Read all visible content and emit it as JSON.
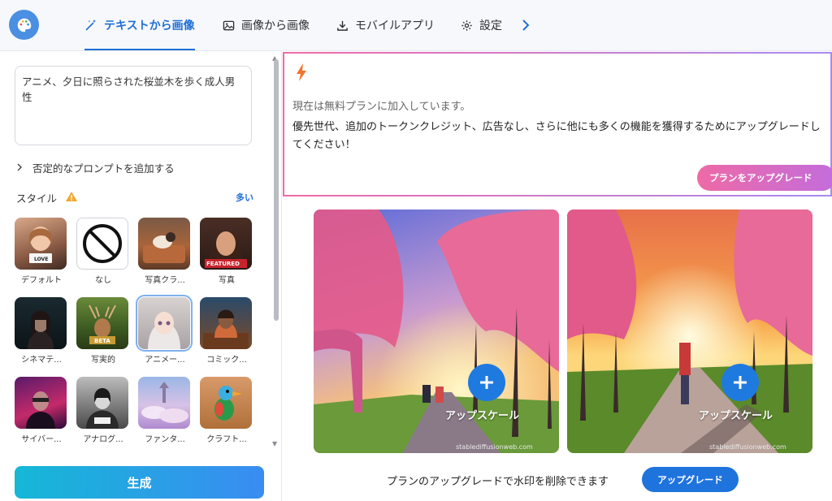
{
  "tabs": [
    {
      "label": "テキストから画像",
      "icon": "magic-wand-icon"
    },
    {
      "label": "画像から画像",
      "icon": "image-icon"
    },
    {
      "label": "モバイルアプリ",
      "icon": "download-icon"
    },
    {
      "label": "設定",
      "icon": "gear-icon"
    }
  ],
  "prompt": {
    "value": "アニメ、夕日に照らされた桜並木を歩く成人男性"
  },
  "negative_prompt_label": "否定的なプロンプトを追加する",
  "style": {
    "header": "スタイル",
    "more": "多い",
    "items": [
      {
        "label": "デフォルト",
        "badge": "LOVE"
      },
      {
        "label": "なし"
      },
      {
        "label": "写真クラ..."
      },
      {
        "label": "写真",
        "badge": "FEATURED"
      },
      {
        "label": "シネマテ..."
      },
      {
        "label": "写実的",
        "badge": "BETA"
      },
      {
        "label": "アニメー..."
      },
      {
        "label": "コミック..."
      },
      {
        "label": "サイバー..."
      },
      {
        "label": "アナログ..."
      },
      {
        "label": "ファンタ..."
      },
      {
        "label": "クラフト..."
      }
    ]
  },
  "generate_label": "生成",
  "banner": {
    "line1": "現在は無料プランに加入しています。",
    "line2": "優先世代、追加のトークンクレジット、広告なし、さらに他にも多くの機能を獲得するためにアップグレードしてください！",
    "button": "プランをアップグレード"
  },
  "results": [
    {
      "upscale_label": "アップスケール",
      "watermark": "stablediffusionweb.com"
    },
    {
      "upscale_label": "アップスケール",
      "watermark": "stablediffusionweb.com"
    }
  ],
  "watermark_text": "プランのアップグレードで水印を削除できます",
  "watermark_button": "アップグレード",
  "colors": {
    "accent": "#1f6fd6",
    "generate_start": "#15b8d6",
    "generate_end": "#3a8cf2",
    "upgrade_pink": "#ee6aa6"
  }
}
